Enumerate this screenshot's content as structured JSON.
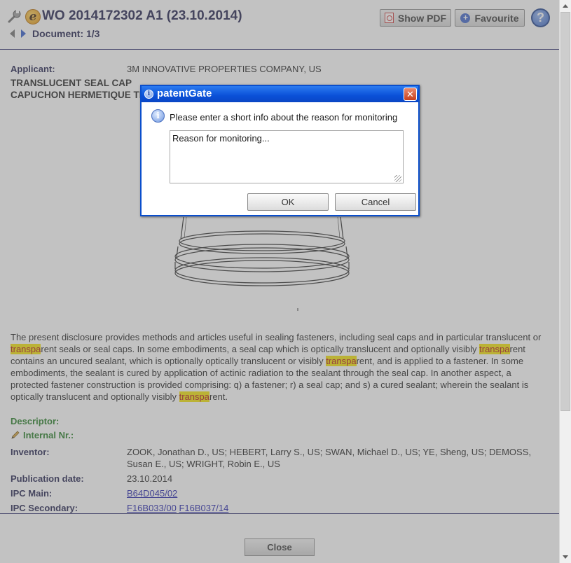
{
  "header": {
    "title": "WO 2014172302 A1 (23.10.2014)",
    "document_nav": "Document: 1/3",
    "show_pdf_label": "Show PDF",
    "favourite_label": "Favourite",
    "help_label": "?"
  },
  "record": {
    "applicant_label": "Applicant:",
    "applicant_value": "3M INNOVATIVE PROPERTIES COMPANY, US",
    "title_en": "TRANSLUCENT SEAL CAP",
    "title_fr": "CAPUCHON HERMETIQUE TRANSLUCIDE",
    "abstract": [
      "The present disclosure provides methods and articles useful in sealing fasteners, including seal caps and in particular translucent or ",
      "transpa",
      "rent seals or seal caps. In some embodiments, a seal cap which is optically translucent and optionally visibly ",
      "transpa",
      "rent contains an uncured sealant, which is optionally optically translucent or visibly ",
      "transpa",
      "rent, and is applied to a fastener. In some embodiments, the sealant is cured by application of actinic radiation to the sealant through the seal cap. In another aspect, a protected fastener construction is provided comprising: q) a fastener; r) a seal cap; and s) a cured sealant; wherein the sealant is optically translucent and optionally visibly ",
      "transpa",
      "rent."
    ],
    "descriptor_label": "Descriptor:",
    "internal_nr_label": "Internal Nr.:",
    "inventor_label": "Inventor:",
    "inventor_value": "ZOOK, Jonathan D., US; HEBERT, Larry S., US; SWAN, Michael D., US; YE, Sheng, US; DEMOSS, Susan E., US; WRIGHT, Robin E., US",
    "pub_date_label": "Publication date:",
    "pub_date_value": "23.10.2014",
    "ipc_main_label": "IPC Main:",
    "ipc_main_value": "B64D045/02",
    "ipc_secondary_label": "IPC Secondary:",
    "ipc_secondary_values": [
      "F16B033/00",
      "F16B037/14"
    ]
  },
  "footer": {
    "close_label": "Close"
  },
  "dialog": {
    "title": "patentGate",
    "close_glyph": "✕",
    "message": "Please enter a short info about the reason for monitoring",
    "input_value": "Reason for monitoring...",
    "ok_label": "OK",
    "cancel_label": "Cancel"
  },
  "colors": {
    "dialog_title_bar": "#0a50d8",
    "highlight_bg": "#f2e200",
    "highlight_text": "#b01010",
    "heading_navy": "#1c1c4a",
    "descriptor_green": "#1f7a1f"
  }
}
